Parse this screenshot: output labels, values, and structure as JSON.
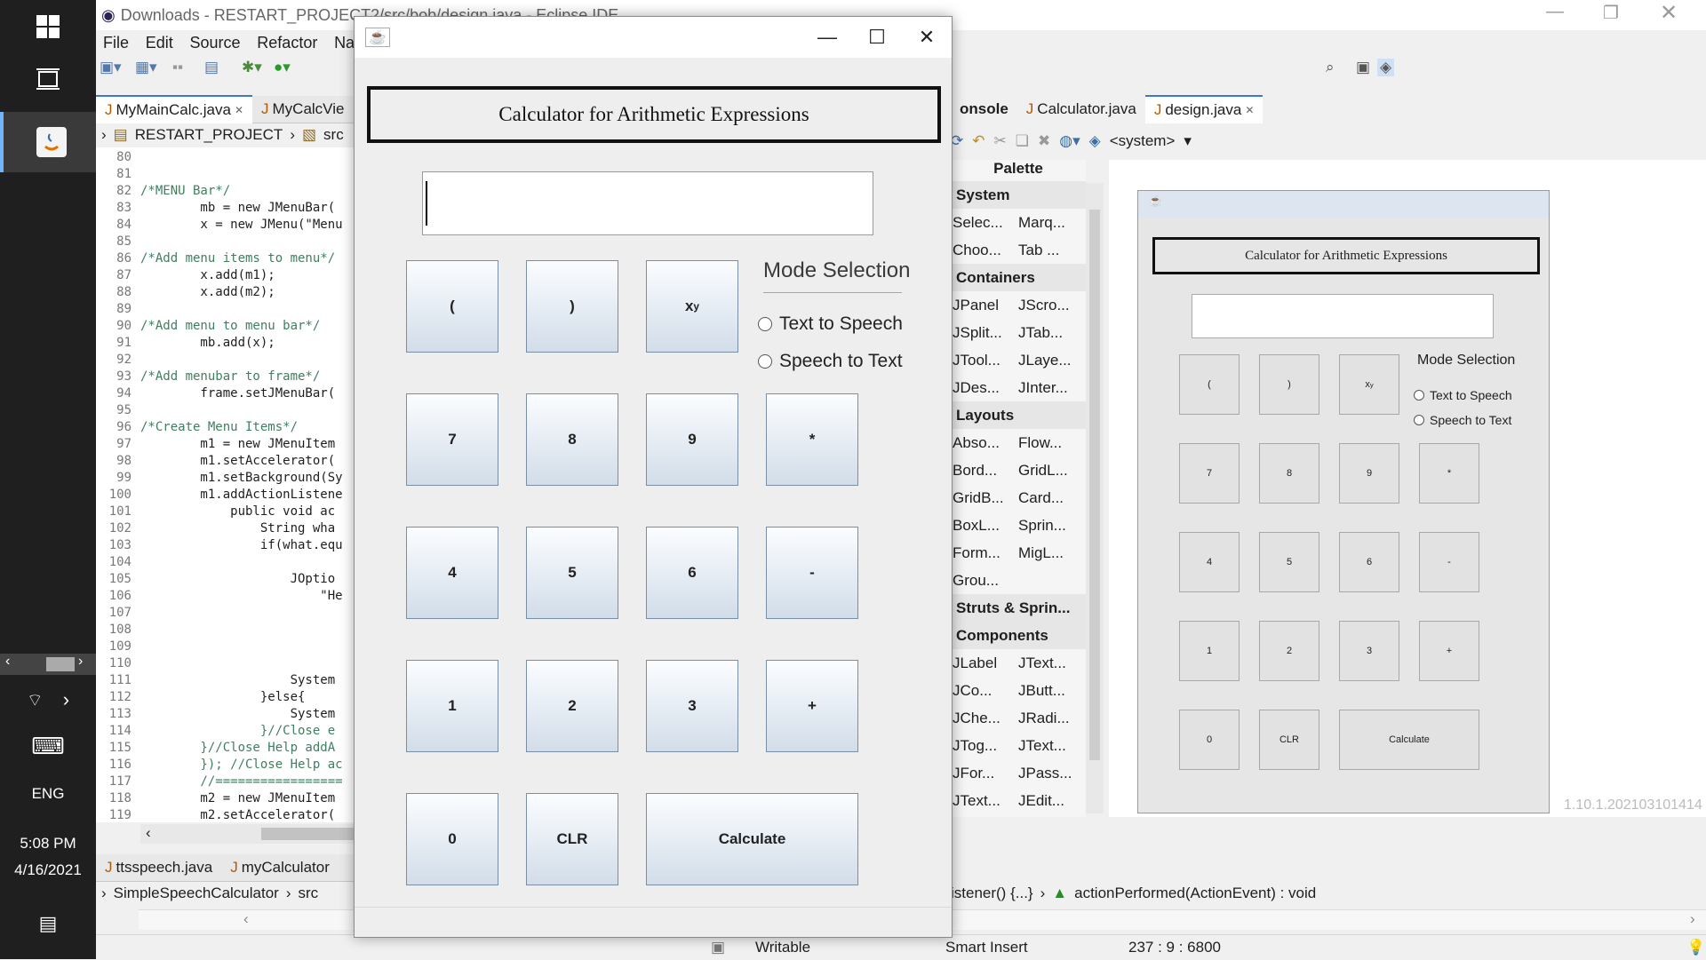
{
  "taskbar": {
    "language": "ENG",
    "time": "5:08 PM",
    "date": "4/16/2021"
  },
  "eclipse": {
    "title": "Downloads - RESTART_PROJECT2/src/bob/design.java - Eclipse IDE",
    "menu": [
      "File",
      "Edit",
      "Source",
      "Refactor",
      "Naviga"
    ],
    "editor_tabs": [
      "MyMainCalc.java",
      "MyCalcVie"
    ],
    "breadcrumb": [
      "RESTART_PROJECT",
      "src"
    ],
    "code_lines": [
      {
        "n": "80",
        "t": ""
      },
      {
        "n": "81",
        "t": ""
      },
      {
        "n": "82",
        "t": "/*MENU Bar*/"
      },
      {
        "n": "83",
        "t": "        mb = new JMenuBar("
      },
      {
        "n": "84",
        "t": "        x = new JMenu(\"Menu"
      },
      {
        "n": "85",
        "t": ""
      },
      {
        "n": "86",
        "t": "/*Add menu items to menu*/"
      },
      {
        "n": "87",
        "t": "        x.add(m1);"
      },
      {
        "n": "88",
        "t": "        x.add(m2);"
      },
      {
        "n": "89",
        "t": ""
      },
      {
        "n": "90",
        "t": "/*Add menu to menu bar*/"
      },
      {
        "n": "91",
        "t": "        mb.add(x);"
      },
      {
        "n": "92",
        "t": ""
      },
      {
        "n": "93",
        "t": "/*Add menubar to frame*/"
      },
      {
        "n": "94",
        "t": "        frame.setJMenuBar("
      },
      {
        "n": "95",
        "t": ""
      },
      {
        "n": "96",
        "t": "/*Create Menu Items*/"
      },
      {
        "n": "97",
        "t": "        m1 = new JMenuItem"
      },
      {
        "n": "98",
        "t": "        m1.setAccelerator("
      },
      {
        "n": "99",
        "t": "        m1.setBackground(Sy"
      },
      {
        "n": "100",
        "t": "        m1.addActionListene"
      },
      {
        "n": "101",
        "t": "            public void ac"
      },
      {
        "n": "102",
        "t": "                String wha"
      },
      {
        "n": "103",
        "t": "                if(what.equ"
      },
      {
        "n": "104",
        "t": ""
      },
      {
        "n": "105",
        "t": "                    JOptio"
      },
      {
        "n": "106",
        "t": "                        \"He"
      },
      {
        "n": "107",
        "t": ""
      },
      {
        "n": "108",
        "t": ""
      },
      {
        "n": "109",
        "t": ""
      },
      {
        "n": "110",
        "t": ""
      },
      {
        "n": "111",
        "t": "                    System"
      },
      {
        "n": "112",
        "t": "                }else{"
      },
      {
        "n": "113",
        "t": "                    System"
      },
      {
        "n": "114",
        "t": "                }//Close e"
      },
      {
        "n": "115",
        "t": "        }//Close Help addA"
      },
      {
        "n": "116",
        "t": "        }); //Close Help ac"
      },
      {
        "n": "117",
        "t": "        //================="
      },
      {
        "n": "118",
        "t": "        m2 = new JMenuItem"
      },
      {
        "n": "119",
        "t": "        m2.setAccelerator("
      }
    ],
    "right_tabs": [
      "onsole",
      "Calculator.java",
      "design.java"
    ],
    "toolbar_system": "<system>",
    "palette": {
      "title": "Palette",
      "rows": [
        {
          "cat": "System"
        },
        {
          "a": "Selec...",
          "b": "Marq..."
        },
        {
          "a": "Choo...",
          "b": "Tab ..."
        },
        {
          "cat": "Containers"
        },
        {
          "a": "JPanel",
          "b": "JScro..."
        },
        {
          "a": "JSplit...",
          "b": "JTab..."
        },
        {
          "a": "JTool...",
          "b": "JLaye..."
        },
        {
          "a": "JDes...",
          "b": "JInter..."
        },
        {
          "cat": "Layouts"
        },
        {
          "a": "Abso...",
          "b": "Flow..."
        },
        {
          "a": "Bord...",
          "b": "GridL..."
        },
        {
          "a": "GridB...",
          "b": "Card..."
        },
        {
          "a": "BoxL...",
          "b": "Sprin..."
        },
        {
          "a": "Form...",
          "b": "MigL..."
        },
        {
          "a": "Grou...",
          "b": ""
        },
        {
          "cat": "Struts & Sprin..."
        },
        {
          "cat": "Components"
        },
        {
          "a": "JLabel",
          "b": "JText..."
        },
        {
          "a": "JCo...",
          "b": "JButt..."
        },
        {
          "a": "JChe...",
          "b": "JRadi..."
        },
        {
          "a": "JTog...",
          "b": "JText..."
        },
        {
          "a": "JFor...",
          "b": "JPass..."
        },
        {
          "a": "JText...",
          "b": "JEdit..."
        }
      ]
    },
    "version": "1.10.1.202103101414",
    "bottom_tabs": [
      "ttsspeech.java",
      "myCalculator"
    ],
    "bottom_breadcrumb": [
      "SimpleSpeechCalculator",
      "src"
    ],
    "bottom_right": [
      "istener() {...}",
      "actionPerformed(ActionEvent) : void"
    ],
    "status": {
      "writable": "Writable",
      "insert": "Smart Insert",
      "position": "237 : 9 : 6800"
    }
  },
  "calculator": {
    "title": "Calculator for Arithmetic Expressions",
    "field_value": "",
    "mode_label": "Mode Selection",
    "radios": [
      "Text to Speech",
      "Speech to Text"
    ],
    "keys": [
      "(",
      ")",
      "x",
      "7",
      "8",
      "9",
      "*",
      "4",
      "5",
      "6",
      "-",
      "1",
      "2",
      "3",
      "+",
      "0",
      "CLR",
      "Calculate"
    ],
    "power_sup": "y"
  },
  "preview": {
    "title": "Calculator for Arithmetic Expressions",
    "mode_label": "Mode Selection",
    "radios": [
      "Text to Speech",
      "Speech to Text"
    ],
    "keys": [
      "(",
      ")",
      "x",
      "7",
      "8",
      "9",
      "*",
      "4",
      "5",
      "6",
      "-",
      "1",
      "2",
      "3",
      "+",
      "0",
      "CLR",
      "Calculate"
    ],
    "power_sup": "y"
  }
}
